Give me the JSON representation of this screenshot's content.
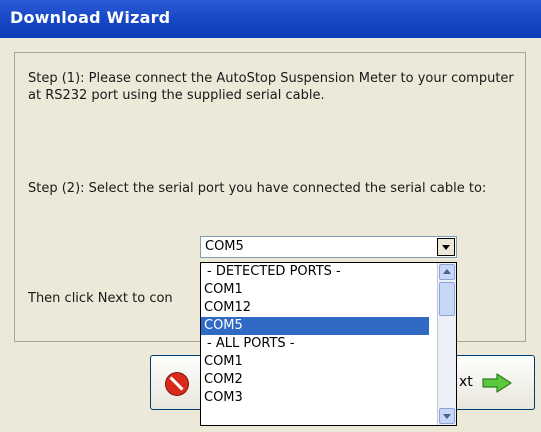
{
  "window": {
    "title": "Download Wizard"
  },
  "instructions": {
    "step1": "Step (1): Please connect the AutoStop Suspension Meter to your computer at RS232 port using the supplied serial cable.",
    "step2": "Step (2): Select the serial port you have connected the serial cable to:",
    "then": "Then click Next to con"
  },
  "port_select": {
    "value": "COM5",
    "options": [
      {
        "label": "- DETECTED PORTS -",
        "selected": false
      },
      {
        "label": "COM1",
        "selected": false
      },
      {
        "label": "COM12",
        "selected": false
      },
      {
        "label": "COM5",
        "selected": true
      },
      {
        "label": "- ALL PORTS -",
        "selected": false
      },
      {
        "label": "COM1",
        "selected": false
      },
      {
        "label": "COM2",
        "selected": false
      },
      {
        "label": "COM3",
        "selected": false
      }
    ]
  },
  "buttons": {
    "next_label": "xt"
  },
  "icons": {
    "cancel": "cancel-icon",
    "next": "next-arrow-icon",
    "dropdown": "chevron-down-icon"
  },
  "colors": {
    "title_bar": "#1a49c8",
    "selection": "#316ac5",
    "next_arrow": "#5ac83c",
    "cancel_icon": "#d62a1d"
  }
}
